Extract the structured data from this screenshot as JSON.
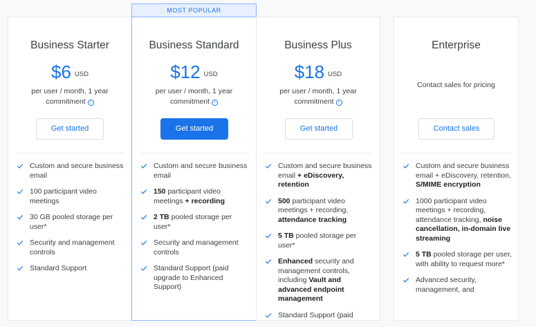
{
  "badge": "MOST POPULAR",
  "plans": [
    {
      "name": "Business Starter",
      "price": "$6",
      "currency": "USD",
      "sub_line1": "per user / month, 1 year",
      "sub_line2": "commitment",
      "button": "Get started",
      "features": [
        [
          "Custom and secure business email"
        ],
        [
          "100 participant video meetings"
        ],
        [
          "30 GB pooled storage per user*"
        ],
        [
          "Security and management controls"
        ],
        [
          "Standard Support"
        ]
      ]
    },
    {
      "name": "Business Standard",
      "price": "$12",
      "currency": "USD",
      "sub_line1": "per user / month, 1 year",
      "sub_line2": "commitment",
      "button": "Get started",
      "features": [
        [
          "Custom and secure business email"
        ],
        [
          "150",
          " participant video meetings ",
          "+ recording"
        ],
        [
          "2 TB",
          " pooled storage per user*"
        ],
        [
          "Security and management controls"
        ],
        [
          "Standard Support (paid upgrade to Enhanced Support)"
        ]
      ]
    },
    {
      "name": "Business Plus",
      "price": "$18",
      "currency": "USD",
      "sub_line1": "per user / month, 1 year",
      "sub_line2": "commitment",
      "button": "Get started",
      "features": [
        [
          "Custom and secure business email ",
          "+ eDiscovery, retention"
        ],
        [
          "500",
          " participant video meetings + recording, ",
          "attendance tracking"
        ],
        [
          "5 TB",
          " pooled storage per user*"
        ],
        [
          "Enhanced",
          " security and management controls, including ",
          "Vault and advanced endpoint management"
        ],
        [
          "Standard Support (paid"
        ]
      ]
    },
    {
      "name": "Enterprise",
      "contact_text": "Contact sales for pricing",
      "button": "Contact sales",
      "features": [
        [
          "Custom and secure business email + eDiscovery, retention, ",
          "S/MIME encryption"
        ],
        [
          "1000 participant video meetings + recording, attendance tracking, ",
          "noise cancellation, in-domain live streaming"
        ],
        [
          "5 TB",
          " pooled storage per user, with ability to request more*"
        ],
        [
          "Advanced security, management, and"
        ]
      ]
    }
  ]
}
